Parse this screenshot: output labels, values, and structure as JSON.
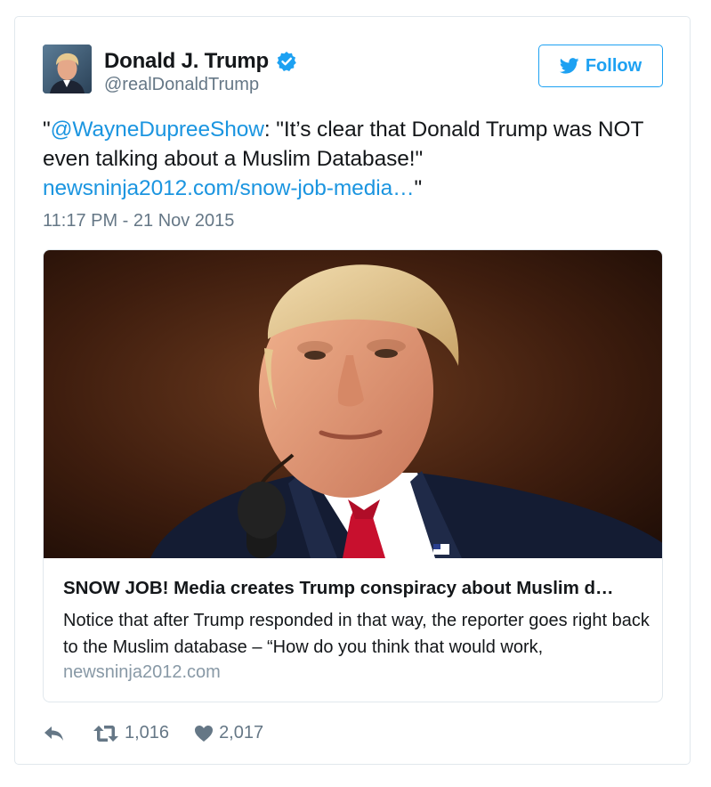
{
  "author": {
    "display_name": "Donald J. Trump",
    "handle": "@realDonaldTrump",
    "verified": true,
    "avatar_icon": "profile-photo"
  },
  "follow_button": {
    "label": "Follow",
    "icon": "twitter-bird-icon",
    "color": "#1da1f2"
  },
  "tweet": {
    "quote_open": "\"",
    "mention": "@WayneDupreeShow",
    "text": ": \"It’s clear that Donald Trump was NOT even talking about a Muslim Database!\"",
    "link": "newsninja2012.com/snow-job-media…",
    "quote_close": "\"",
    "timestamp": "11:17 PM - 21 Nov 2015",
    "link_color": "#1b95e0"
  },
  "link_card": {
    "image_subject": "photo of man in suit at microphone",
    "title": "SNOW JOB! Media creates Trump conspiracy about Muslim d…",
    "description": "Notice that after Trump responded in that way, the reporter goes right back to the Muslim database – “How do you think that would work,",
    "domain": "newsninja2012.com"
  },
  "actions": {
    "reply_icon": "reply-icon",
    "retweet_icon": "retweet-icon",
    "retweet_count": "1,016",
    "like_icon": "heart-icon",
    "like_count": "2,017"
  }
}
